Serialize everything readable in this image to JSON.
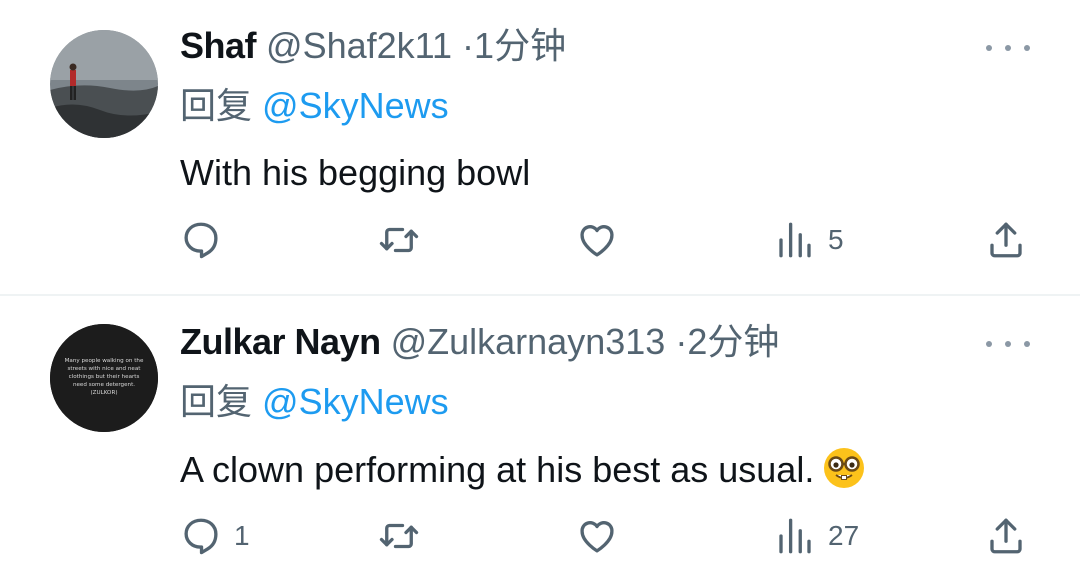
{
  "tweets": [
    {
      "name": "Shaf",
      "handle": "@Shaf2k11",
      "separator": "·",
      "time": "1分钟",
      "reply_prefix": "回复",
      "reply_to": "@SkyNews",
      "text": "With his begging bowl",
      "reply_count": "",
      "views": "5"
    },
    {
      "name": "Zulkar Nayn",
      "handle": "@Zulkarnayn313",
      "separator": "·",
      "time": "2分钟",
      "reply_prefix": "回复",
      "reply_to": "@SkyNews",
      "text": "A clown performing at his best as usual.",
      "emoji": "nerd-face-icon",
      "reply_count": "1",
      "views": "27",
      "avatar_text": [
        "Many people walking on the",
        "streets with nice and neat",
        "clothings but their hearts",
        "need some detergent.",
        "(ZULKOR)"
      ]
    }
  ],
  "colors": {
    "text": "#0f1419",
    "secondary": "#536471",
    "link": "#1d9bf0",
    "divider": "#eff3f4"
  }
}
